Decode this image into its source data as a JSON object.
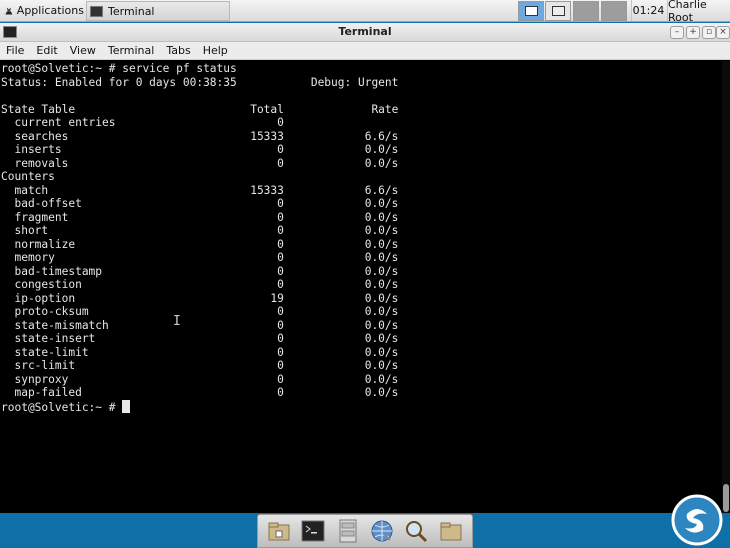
{
  "panel": {
    "applications_label": "Applications",
    "task_label": "Terminal",
    "clock": "01:24",
    "user": "Charlie Root"
  },
  "window": {
    "title": "Terminal",
    "menu": [
      "File",
      "Edit",
      "View",
      "Terminal",
      "Tabs",
      "Help"
    ]
  },
  "terminal": {
    "lines": [
      "root@Solvetic:~ # service pf status",
      "Status: Enabled for 0 days 00:38:35           Debug: Urgent",
      "",
      "State Table                          Total             Rate",
      "  current entries                        0",
      "  searches                           15333            6.6/s",
      "  inserts                                0            0.0/s",
      "  removals                               0            0.0/s",
      "Counters",
      "  match                              15333            6.6/s",
      "  bad-offset                             0            0.0/s",
      "  fragment                               0            0.0/s",
      "  short                                  0            0.0/s",
      "  normalize                              0            0.0/s",
      "  memory                                 0            0.0/s",
      "  bad-timestamp                          0            0.0/s",
      "  congestion                             0            0.0/s",
      "  ip-option                             19            0.0/s",
      "  proto-cksum                            0            0.0/s",
      "  state-mismatch                         0            0.0/s",
      "  state-insert                           0            0.0/s",
      "  state-limit                            0            0.0/s",
      "  src-limit                              0            0.0/s",
      "  synproxy                               0            0.0/s",
      "  map-failed                             0            0.0/s"
    ],
    "prompt": "root@Solvetic:~ # "
  },
  "dock": {
    "icons": [
      "home-folder-icon",
      "terminal-icon",
      "file-cabinet-icon",
      "web-browser-icon",
      "search-icon",
      "folder-icon"
    ]
  },
  "colors": {
    "desktop": "#0f70a8",
    "terminal_bg": "#000000",
    "terminal_fg": "#e6e6e6",
    "logo": "#2e86c1"
  }
}
